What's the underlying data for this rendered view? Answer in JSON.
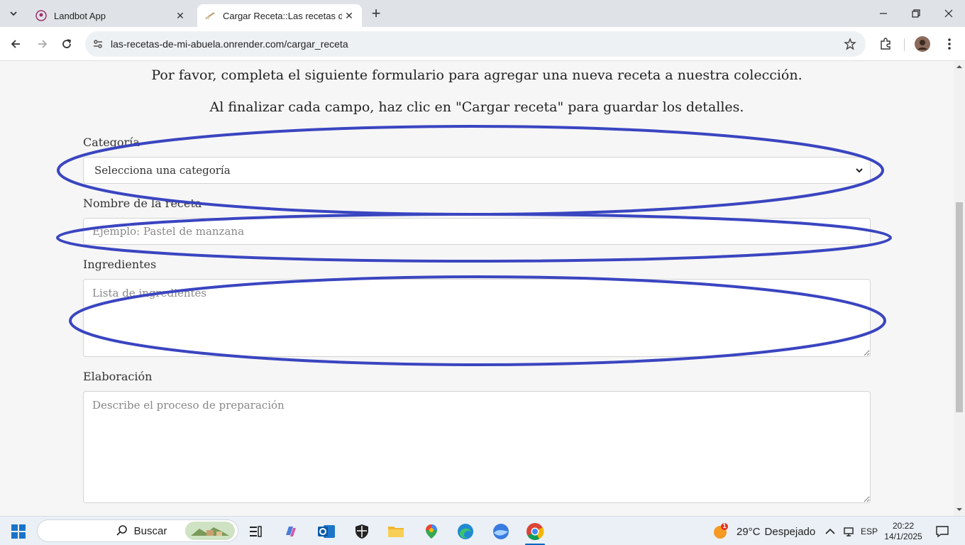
{
  "browser": {
    "tabs": [
      {
        "title": "Landbot App",
        "active": false
      },
      {
        "title": "Cargar Receta::Las recetas de m",
        "active": true
      }
    ],
    "url": "las-recetas-de-mi-abuela.onrender.com/cargar_receta"
  },
  "form": {
    "intro_line1": "Por favor, completa el siguiente formulario para agregar una nueva receta a nuestra colección.",
    "intro_line2": "Al finalizar cada campo, haz clic en \"Cargar receta\" para guardar los detalles.",
    "categoria_label": "Categoría",
    "categoria_selected": "Selecciona una categoría",
    "nombre_label": "Nombre de la receta",
    "nombre_placeholder": "Ejemplo: Pastel de manzana",
    "ingredientes_label": "Ingredientes",
    "ingredientes_placeholder": "Lista de ingredientes",
    "elaboracion_label": "Elaboración",
    "elaboracion_placeholder": "Describe el proceso de preparación"
  },
  "annotations": {
    "color": "#3a45c0"
  },
  "taskbar": {
    "search_label": "Buscar",
    "weather_temp": "29°C",
    "weather_text": "Despejado",
    "weather_badge": "1",
    "language": "ESP",
    "time": "20:22",
    "date": "14/1/2025"
  }
}
